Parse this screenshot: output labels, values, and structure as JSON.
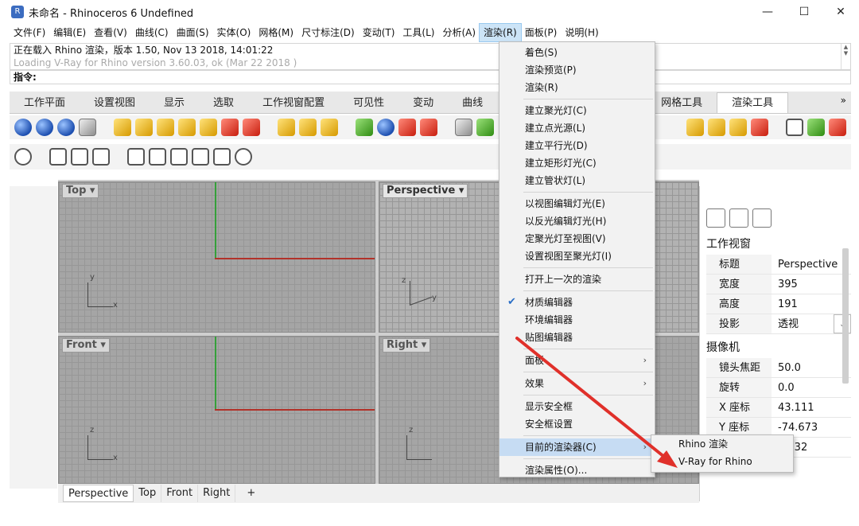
{
  "window": {
    "title": "未命名 - Rhinoceros 6 Undefined",
    "icon": "rhino-icon",
    "minimize": "—",
    "maximize": "☐",
    "close": "✕"
  },
  "menubar": [
    "文件(F)",
    "编辑(E)",
    "查看(V)",
    "曲线(C)",
    "曲面(S)",
    "实体(O)",
    "网格(M)",
    "尺寸标注(D)",
    "变动(T)",
    "工具(L)",
    "分析(A)",
    "渲染(R)",
    "面板(P)",
    "说明(H)"
  ],
  "command": {
    "history": [
      "正在载入 Rhino 渲染，版本 1.50, Nov 13 2018, 14:01:22",
      "Loading V-Ray for Rhino version 3.60.03, ok (Mar 22 2018 )"
    ],
    "prompt": "指令:"
  },
  "tabs": [
    "工作平面",
    "设置视图",
    "显示",
    "选取",
    "工作视窗配置",
    "可见性",
    "变动",
    "曲线",
    "网格工具",
    "渲染工具"
  ],
  "tab_more": "»",
  "viewports": {
    "top": "Top",
    "perspective": "Perspective",
    "front": "Front",
    "right": "Right",
    "axis_x": "x",
    "axis_y": "y",
    "axis_z": "z"
  },
  "viewport_tabs": [
    "Perspective",
    "Top",
    "Front",
    "Right"
  ],
  "add_tab": "+",
  "render_menu": {
    "items": [
      {
        "label": "着色(S)"
      },
      {
        "label": "渲染预览(P)"
      },
      {
        "label": "渲染(R)"
      },
      {
        "sep": true
      },
      {
        "label": "建立聚光灯(C)"
      },
      {
        "label": "建立点光源(L)"
      },
      {
        "label": "建立平行光(D)"
      },
      {
        "label": "建立矩形灯光(C)"
      },
      {
        "label": "建立管状灯(L)"
      },
      {
        "sep": true
      },
      {
        "label": "以视图编辑灯光(E)"
      },
      {
        "label": "以反光编辑灯光(H)"
      },
      {
        "label": "定聚光灯至视图(V)"
      },
      {
        "label": "设置视图至聚光灯(I)"
      },
      {
        "sep": true
      },
      {
        "label": "打开上一次的渲染"
      },
      {
        "sep": true
      },
      {
        "label": "材质编辑器",
        "checked": true
      },
      {
        "label": "环境编辑器"
      },
      {
        "label": "贴图编辑器"
      },
      {
        "sep": true
      },
      {
        "label": "面板",
        "arrow": true
      },
      {
        "sep": true
      },
      {
        "label": "效果",
        "arrow": true
      },
      {
        "sep": true
      },
      {
        "label": "显示安全框"
      },
      {
        "label": "安全框设置"
      },
      {
        "sep": true
      },
      {
        "label": "目前的渲染器(C)",
        "arrow": true,
        "highlighted": true
      },
      {
        "sep": true
      },
      {
        "label": "渲染属性(O)..."
      }
    ],
    "check_glyph": "✔",
    "arrow_glyph": "›"
  },
  "renderer_submenu": [
    "Rhino 渲染",
    "V-Ray for Rhino"
  ],
  "properties": {
    "section_viewport": "工作视窗",
    "viewport_rows": [
      {
        "key": "标题",
        "value": "Perspective"
      },
      {
        "key": "宽度",
        "value": "395"
      },
      {
        "key": "高度",
        "value": "191"
      },
      {
        "key": "投影",
        "value": "透视",
        "dropdown": true
      }
    ],
    "section_camera": "摄像机",
    "camera_rows": [
      {
        "key": "镜头焦距",
        "value": "50.0"
      },
      {
        "key": "旋转",
        "value": "0.0"
      },
      {
        "key": "X 座标",
        "value": "43.111"
      },
      {
        "key": "Y 座标",
        "value": "-74.673"
      },
      {
        "key": "Z 座标",
        "value": "51.32"
      }
    ],
    "dropdown_glyph": "⌄"
  },
  "colors": {
    "menu_highlight": "#c6dcf3",
    "axis_x": "#b2322a",
    "axis_y": "#35a03a",
    "arrow": "#e0302a"
  }
}
